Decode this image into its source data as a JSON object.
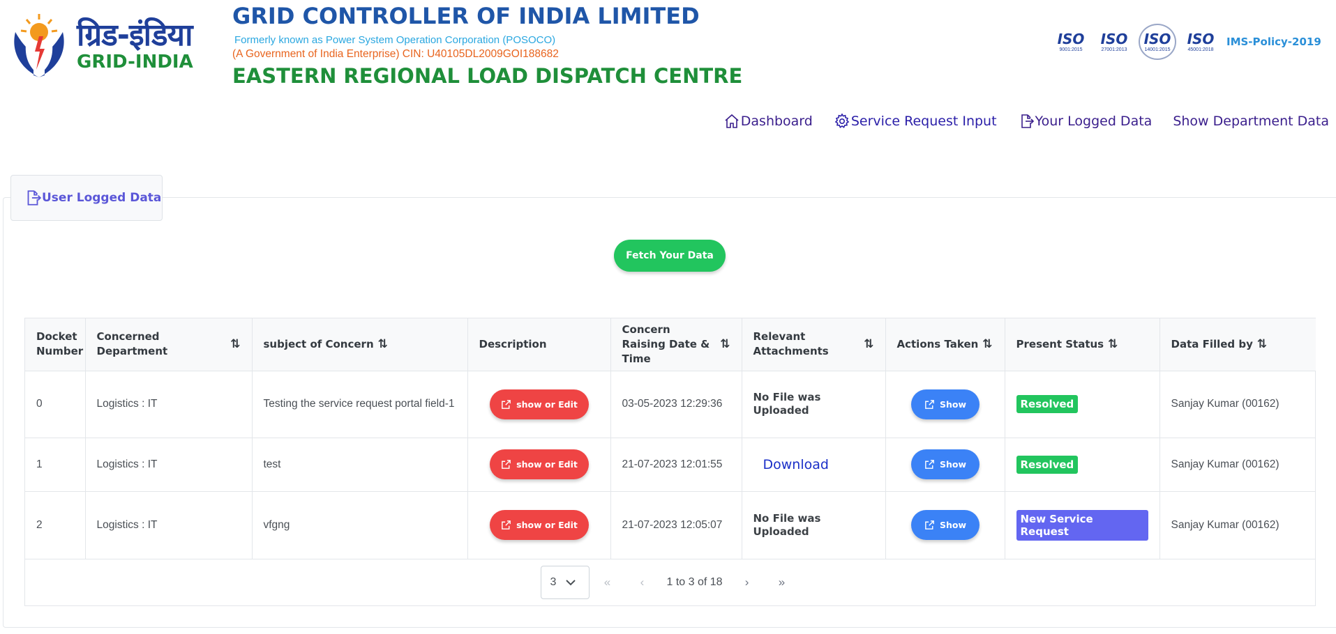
{
  "header": {
    "logo_hindi": "ग्रिड-इंडिया",
    "logo_english": "GRID-INDIA",
    "title": "GRID CONTROLLER OF INDIA LIMITED",
    "formerly": "Formerly known as Power System Operation Corporation (POSOCO)",
    "govt": "(A Government of India Enterprise) CIN: U40105DL2009GOI188682",
    "centre": "EASTERN REGIONAL LOAD DISPATCH CENTRE",
    "iso_badges": [
      {
        "word": "ISO",
        "sub": "9001:2015"
      },
      {
        "word": "ISO",
        "sub": "27001:2013"
      },
      {
        "word": "ISO",
        "sub": "14001:2015"
      },
      {
        "word": "ISO",
        "sub": "45001:2018"
      }
    ],
    "ims_policy": "IMS-Policy-2019"
  },
  "nav": {
    "items": [
      {
        "label": "Dashboard",
        "icon": "home-icon"
      },
      {
        "label": "Service Request Input",
        "icon": "gear-icon"
      },
      {
        "label": "Your Logged Data",
        "icon": "file-export-icon"
      },
      {
        "label": "Show Department Data",
        "icon": ""
      }
    ]
  },
  "panel": {
    "tab_label": "User Logged Data",
    "fetch_button": "Fetch Your Data"
  },
  "table": {
    "columns": [
      "Docket Number",
      "Concerned Department",
      "subject of Concern",
      "Description",
      "Concern Raising Date & Time",
      "Relevant Attachments",
      "Actions Taken",
      "Present Status",
      "Data Filled by"
    ],
    "rows": [
      {
        "docket": "0",
        "department": "Logistics : IT",
        "subject": "Testing the service request portal field-1",
        "description_btn": "show or Edit",
        "datetime": "03-05-2023 12:29:36",
        "attachment": "No File was Uploaded",
        "action_btn": "Show",
        "status": "Resolved",
        "filled_by": "Sanjay Kumar (00162)"
      },
      {
        "docket": "1",
        "department": "Logistics : IT",
        "subject": "test",
        "description_btn": "show or Edit",
        "datetime": "21-07-2023 12:01:55",
        "attachment": "Download",
        "action_btn": "Show",
        "status": "Resolved",
        "filled_by": "Sanjay Kumar (00162)"
      },
      {
        "docket": "2",
        "department": "Logistics : IT",
        "subject": "vfgng",
        "description_btn": "show or Edit",
        "datetime": "21-07-2023 12:05:07",
        "attachment": "No File was Uploaded",
        "action_btn": "Show",
        "status": "New Service Request",
        "filled_by": "Sanjay Kumar (00162)"
      }
    ]
  },
  "paginator": {
    "rows_per_page": "3",
    "first": "«",
    "prev": "‹",
    "page_report": "1 to 3 of 18",
    "next": "›",
    "last": "»"
  },
  "colors": {
    "title_blue": "#1f56a8",
    "centre_green": "#1f8f3a",
    "nav_purple": "#3a1e8c",
    "fetch_green": "#22c55e",
    "edit_red": "#ef4444",
    "show_blue": "#3b82f6",
    "resolved_green": "#22c55e",
    "new_purple": "#6366f1"
  }
}
